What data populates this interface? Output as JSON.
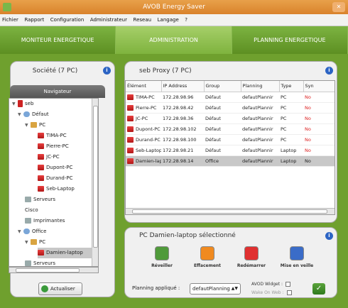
{
  "window": {
    "title": "AVOB Energy Saver"
  },
  "menu": [
    "Fichier",
    "Rapport",
    "Configuration",
    "Administrateur",
    "Reseau",
    "Langage",
    "?"
  ],
  "tabs": [
    {
      "label": "MONITEUR ENERGETIQUE"
    },
    {
      "label": "ADMINISTRATION",
      "active": true
    },
    {
      "label": "PLANNING ENERGETIQUE"
    }
  ],
  "left": {
    "title": "Société (7 PC)",
    "nav_header": "Navigateur",
    "tree": [
      {
        "label": "seb",
        "type": "root",
        "level": 0,
        "arrow": "▼"
      },
      {
        "label": "Défaut",
        "type": "group",
        "level": 1,
        "arrow": "▼"
      },
      {
        "label": "PC",
        "type": "folder",
        "level": 2,
        "arrow": "▼"
      },
      {
        "label": "TIMA-PC",
        "type": "pc",
        "level": 3
      },
      {
        "label": "Pierre-PC",
        "type": "pc",
        "level": 3
      },
      {
        "label": "JC-PC",
        "type": "pc",
        "level": 3
      },
      {
        "label": "Dupont-PC",
        "type": "pc",
        "level": 3
      },
      {
        "label": "Durand-PC",
        "type": "pc",
        "level": 3
      },
      {
        "label": "Seb-Laptop",
        "type": "pc",
        "level": 3
      },
      {
        "label": "Serveurs",
        "type": "server",
        "level": 2
      },
      {
        "label": "Cisco",
        "type": "plain",
        "level": 2
      },
      {
        "label": "Imprimantes",
        "type": "server",
        "level": 2
      },
      {
        "label": "Office",
        "type": "group",
        "level": 1,
        "arrow": "▼"
      },
      {
        "label": "PC",
        "type": "folder",
        "level": 2,
        "arrow": "▼"
      },
      {
        "label": "Damien-laptop",
        "type": "pc",
        "level": 3,
        "selected": true
      },
      {
        "label": "Serveurs",
        "type": "server",
        "level": 2
      }
    ],
    "refresh_label": "Actualiser"
  },
  "proxy": {
    "title": "seb Proxy (7 PC)",
    "columns": [
      "Élément",
      "IP Address",
      "Group",
      "Planning",
      "Type",
      "Syn"
    ],
    "rows": [
      [
        "TIMA-PC",
        "172.28.98.96",
        "Défaut",
        "defautPlannir",
        "PC",
        "No"
      ],
      [
        "Pierre-PC",
        "172.28.98.42",
        "Défaut",
        "defautPlannir",
        "PC",
        "No"
      ],
      [
        "JC-PC",
        "172.28.98.36",
        "Défaut",
        "defautPlannir",
        "PC",
        "No"
      ],
      [
        "Dupont-PC",
        "172.28.98.102",
        "Défaut",
        "defautPlannir",
        "PC",
        "No"
      ],
      [
        "Durand-PC",
        "172.28.98.100",
        "Défaut",
        "defautPlannir",
        "PC",
        "No"
      ],
      [
        "Seb-Laptop",
        "172.28.98.21",
        "Défaut",
        "defautPlannir",
        "Laptop",
        "No"
      ],
      [
        "Damien-lap",
        "172.28.98.14",
        "Office",
        "defautPlannir",
        "Laptop",
        "No"
      ]
    ],
    "selected_row": 6
  },
  "selection": {
    "title": "PC Damien-laptop sélectionné",
    "actions": [
      {
        "label": "Réveiller",
        "icon": "clock-icon",
        "color": "#4f9a3a"
      },
      {
        "label": "Effacement",
        "icon": "pulse-icon",
        "color": "#f08a1f"
      },
      {
        "label": "Redémarrer",
        "icon": "power-icon",
        "color": "#e03030"
      },
      {
        "label": "Mise en veille",
        "icon": "moon-icon",
        "color": "#3a6cc8"
      }
    ],
    "planning_label": "Planning appliqué :",
    "planning_value": "defautPlanning",
    "widget_label": "AVOD Widget :",
    "wake_label": "Wake On Web :"
  }
}
